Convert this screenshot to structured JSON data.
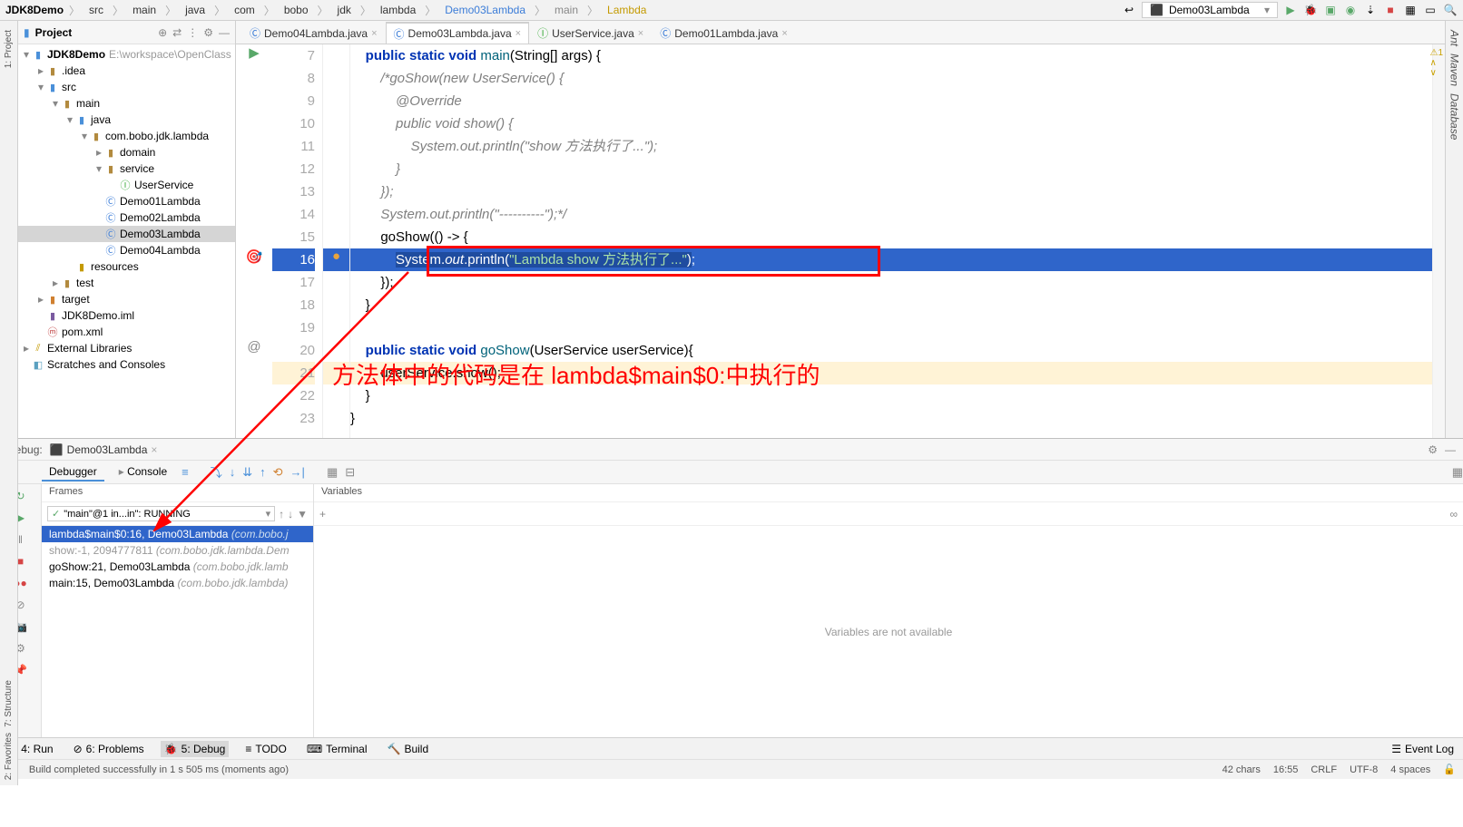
{
  "breadcrumb": [
    "JDK8Demo",
    "src",
    "main",
    "java",
    "com",
    "bobo",
    "jdk",
    "lambda",
    "Demo03Lambda",
    "main",
    "Lambda"
  ],
  "run_config": "Demo03Lambda",
  "right_tools": [
    "Ant",
    "Maven",
    "Database"
  ],
  "left_tools": {
    "project": "1: Project",
    "structure": "7: Structure",
    "favorites": "2: Favorites"
  },
  "project": {
    "title": "Project",
    "root": "JDK8Demo",
    "root_path": "E:\\workspace\\OpenClass",
    "nodes": {
      "idea": ".idea",
      "src": "src",
      "main": "main",
      "java": "java",
      "pkg": "com.bobo.jdk.lambda",
      "domain": "domain",
      "service": "service",
      "userservice": "UserService",
      "d1": "Demo01Lambda",
      "d2": "Demo02Lambda",
      "d3": "Demo03Lambda",
      "d4": "Demo04Lambda",
      "resources": "resources",
      "test": "test",
      "target": "target",
      "iml": "JDK8Demo.iml",
      "pom": "pom.xml",
      "ext": "External Libraries",
      "scratch": "Scratches and Consoles"
    }
  },
  "tabs": [
    {
      "label": "Demo04Lambda.java",
      "active": false
    },
    {
      "label": "Demo03Lambda.java",
      "active": true
    },
    {
      "label": "UserService.java",
      "active": false
    },
    {
      "label": "Demo01Lambda.java",
      "active": false
    }
  ],
  "code": {
    "lines": [
      7,
      8,
      9,
      10,
      11,
      12,
      13,
      14,
      15,
      16,
      17,
      18,
      19,
      20,
      21,
      22,
      23
    ],
    "l7": "    public static void main(String[] args) {",
    "l8": "        /*goShow(new UserService() {",
    "l9": "            @Override",
    "l10": "            public void show() {",
    "l11": "                System.out.println(\"show 方法执行了...\");",
    "l12": "            }",
    "l13": "        });",
    "l14": "        System.out.println(\"----------\");*/",
    "l15": "        goShow(() -> {",
    "l16": "            System.out.println(\"Lambda show 方法执行了...\");",
    "l17": "        });",
    "l18": "    }",
    "l19": "",
    "l20": "    public static void goShow(UserService userService){",
    "l21": "        userService.show();",
    "l22": "    }",
    "l23": "}"
  },
  "warnings": "1",
  "annotation": "方法体中的代码是在 lambda$main$0:中执行的",
  "debug": {
    "label": "Debug:",
    "config": "Demo03Lambda",
    "tabs": {
      "debugger": "Debugger",
      "console": "Console"
    },
    "frames_hdr": "Frames",
    "vars_hdr": "Variables",
    "thread": "\"main\"@1 in...in\": RUNNING",
    "frames": [
      {
        "text": "lambda$main$0:16, Demo03Lambda",
        "cls": "(com.bobo.j",
        "sel": true
      },
      {
        "text": "show:-1, 2094777811",
        "cls": "(com.bobo.jdk.lambda.Dem",
        "dim": true
      },
      {
        "text": "goShow:21, Demo03Lambda",
        "cls": "(com.bobo.jdk.lamb"
      },
      {
        "text": "main:15, Demo03Lambda",
        "cls": "(com.bobo.jdk.lambda)"
      }
    ],
    "vars_empty": "Variables are not available"
  },
  "bottom_tabs": {
    "run": "4: Run",
    "problems": "6: Problems",
    "debug": "5: Debug",
    "todo": "TODO",
    "terminal": "Terminal",
    "build": "Build",
    "eventlog": "Event Log"
  },
  "status": {
    "msg": "Build completed successfully in 1 s 505 ms (moments ago)",
    "chars": "42 chars",
    "pos": "16:55",
    "le": "CRLF",
    "enc": "UTF-8",
    "indent": "4 spaces"
  }
}
